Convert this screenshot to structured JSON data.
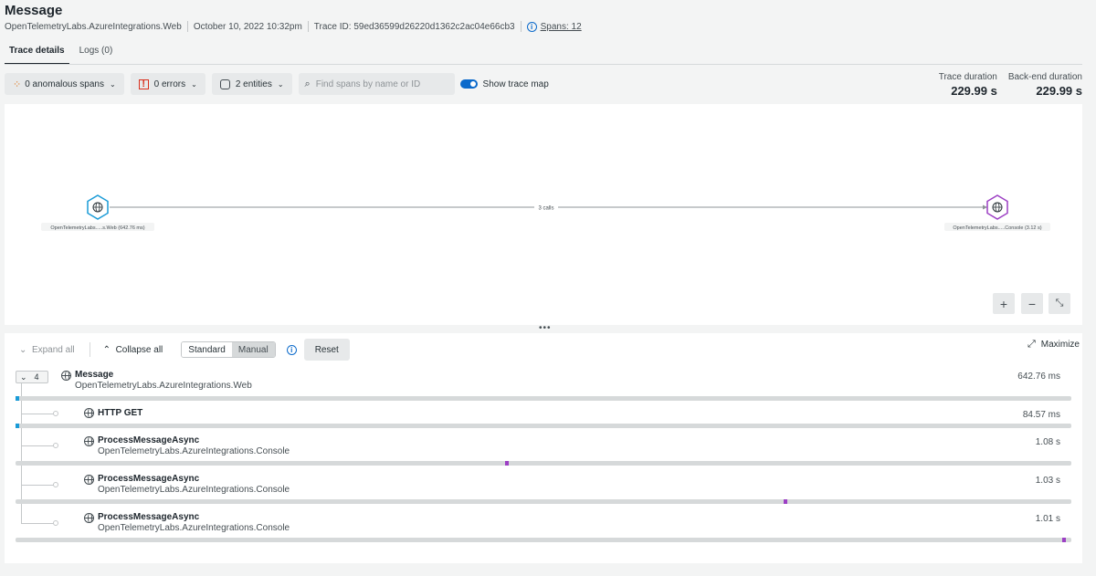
{
  "header": {
    "title": "Message",
    "service": "OpenTelemetryLabs.AzureIntegrations.Web",
    "timestamp": "October 10, 2022 10:32pm",
    "trace_id": "Trace ID: 59ed36599d26220d1362c2ac04e66cb3",
    "spans_link": "Spans: 12"
  },
  "tabs": [
    {
      "label": "Trace details",
      "active": true
    },
    {
      "label": "Logs (0)",
      "active": false
    }
  ],
  "toolbar": {
    "anomalous": "0 anomalous spans",
    "errors": "0 errors",
    "entities": "2 entities",
    "search_placeholder": "Find spans by name or ID",
    "toggle_label": "Show trace map",
    "toggle_on": true
  },
  "durations": {
    "trace_label": "Trace duration",
    "trace_value": "229.99 s",
    "backend_label": "Back-end duration",
    "backend_value": "229.99 s"
  },
  "trace_map": {
    "left_node": "OpenTelemetryLabs.....s.Web (642.76 ms)",
    "right_node": "OpenTelemetryLabs.....Console (3.12 s)",
    "edge_label": "3 calls",
    "left_color": "#1a9bd7",
    "right_color": "#9c3fc4",
    "zoom_in": "+",
    "zoom_out": "−",
    "fit": "⤡"
  },
  "waterfall": {
    "expand_all": "Expand all",
    "collapse_all": "Collapse all",
    "mode_standard": "Standard",
    "mode_manual": "Manual",
    "reset": "Reset",
    "maximize": "Maximize",
    "root_count": "4",
    "spans": [
      {
        "name": "Message",
        "service": "OpenTelemetryLabs.AzureIntegrations.Web",
        "duration": "642.76 ms",
        "start_fraction": 0.0,
        "color": "#1a9bd7"
      },
      {
        "name": "HTTP GET",
        "service": "",
        "duration": "84.57 ms",
        "start_fraction": 0.0,
        "color": "#1a9bd7"
      },
      {
        "name": "ProcessMessageAsync",
        "service": "OpenTelemetryLabs.AzureIntegrations.Console",
        "duration": "1.08 s",
        "start_fraction": 0.465,
        "color": "#9c3fc4"
      },
      {
        "name": "ProcessMessageAsync",
        "service": "OpenTelemetryLabs.AzureIntegrations.Console",
        "duration": "1.03 s",
        "start_fraction": 0.73,
        "color": "#9c3fc4"
      },
      {
        "name": "ProcessMessageAsync",
        "service": "OpenTelemetryLabs.AzureIntegrations.Console",
        "duration": "1.01 s",
        "start_fraction": 0.995,
        "color": "#9c3fc4"
      }
    ]
  }
}
